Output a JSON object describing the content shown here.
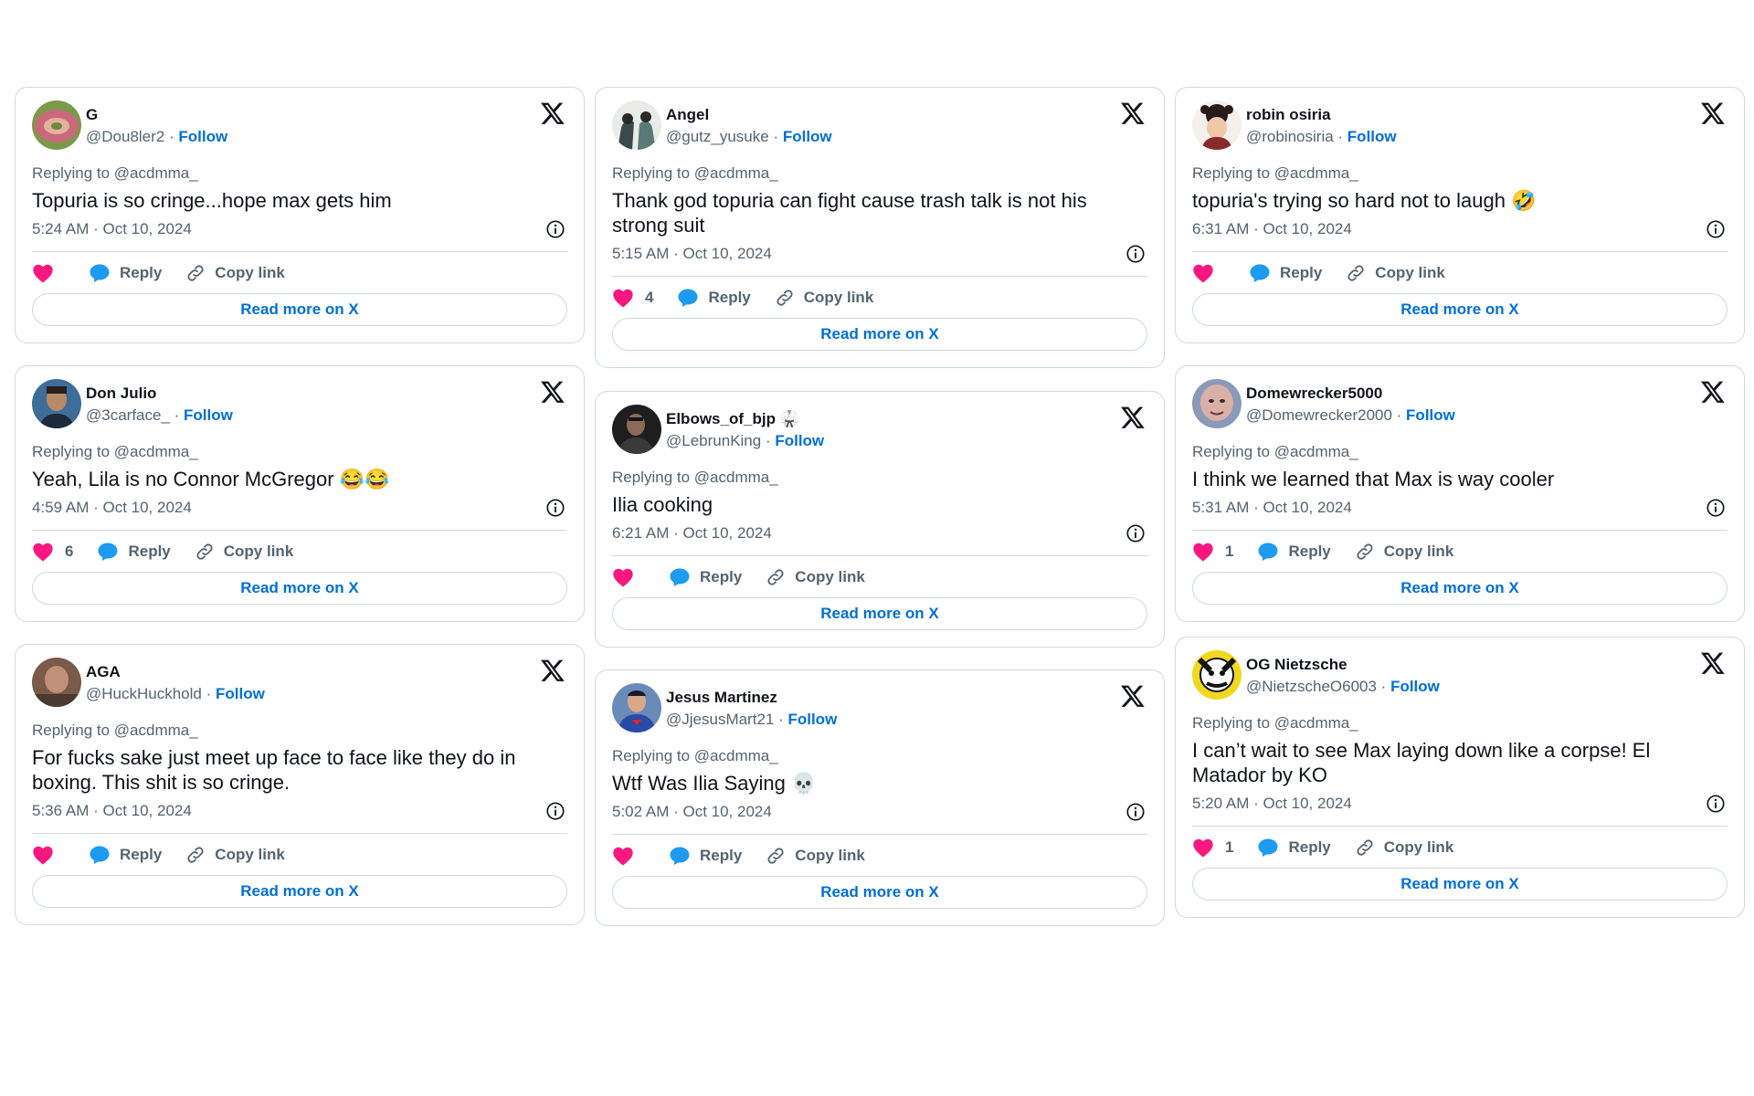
{
  "colors": {
    "link": "#006fd6",
    "heart": "#f91880",
    "reply": "#1d9bf0",
    "border": "#cfd9de",
    "muted": "#536471"
  },
  "labels": {
    "reply": "Reply",
    "copy_link": "Copy link",
    "read_more": "Read more on X",
    "follow": "Follow",
    "sep": " · "
  },
  "columns": [
    [
      {
        "name": "G",
        "badge": "",
        "handle": "@Dou8ler2",
        "replying": "Replying to @acdmma_",
        "text": "Topuria is so cringe...hope max gets him",
        "time": "5:24 AM · Oct 10, 2024",
        "likes": "",
        "avatar": "green-donut"
      },
      {
        "name": "Don Julio",
        "badge": "",
        "handle": "@3carface_",
        "replying": "Replying to @acdmma_",
        "text": "Yeah, Lila is no Connor McGregor 😂😂",
        "time": "4:59 AM · Oct 10, 2024",
        "likes": "6",
        "avatar": "man-blue"
      },
      {
        "name": "AGA",
        "badge": "",
        "handle": "@HuckHuckhold",
        "replying": "Replying to @acdmma_",
        "text": "For fucks sake just meet up face to face like they do in boxing. This shit is so cringe.",
        "time": "5:36 AM · Oct 10, 2024",
        "likes": "",
        "avatar": "brown-blur"
      }
    ],
    [
      {
        "name": "Angel",
        "badge": "",
        "handle": "@gutz_yusuke",
        "replying": "Replying to @acdmma_",
        "text": "Thank god topuria can fight cause trash talk is not his strong suit",
        "time": "5:15 AM · Oct 10, 2024",
        "likes": "4",
        "avatar": "anime-pair"
      },
      {
        "name": "Elbows_of_bjp",
        "badge": "🥋",
        "handle": "@LebrunKing",
        "replying": "Replying to @acdmma_",
        "text": "Ilia cooking",
        "time": "6:21 AM · Oct 10, 2024",
        "likes": "",
        "avatar": "dark-man"
      },
      {
        "name": "Jesus Martinez",
        "badge": "",
        "handle": "@JjesusMart21",
        "replying": "Replying to @acdmma_",
        "text": "Wtf Was Ilia Saying 💀",
        "time": "5:02 AM · Oct 10, 2024",
        "likes": "",
        "avatar": "superhero"
      }
    ],
    [
      {
        "name": "robin osiria",
        "badge": "",
        "handle": "@robinosiria",
        "replying": "Replying to @acdmma_",
        "text": "topuria's trying so hard not to laugh 🤣",
        "time": "6:31 AM · Oct 10, 2024",
        "likes": "",
        "avatar": "anime-girl"
      },
      {
        "name": "Domewrecker5000",
        "badge": "",
        "handle": "@Domewrecker2000",
        "replying": "Replying to @acdmma_",
        "text": "I think we learned that Max is way cooler",
        "time": "5:31 AM · Oct 10, 2024",
        "likes": "1",
        "avatar": "bald-man"
      },
      {
        "name": "OG Nietzsche",
        "badge": "",
        "handle": "@NietzscheO6003",
        "replying": "Replying to @acdmma_",
        "text": "I can’t wait to see Max laying down like a corpse! El Matador by KO",
        "time": "5:20 AM · Oct 10, 2024",
        "likes": "1",
        "avatar": "cartoon-bw"
      }
    ]
  ]
}
